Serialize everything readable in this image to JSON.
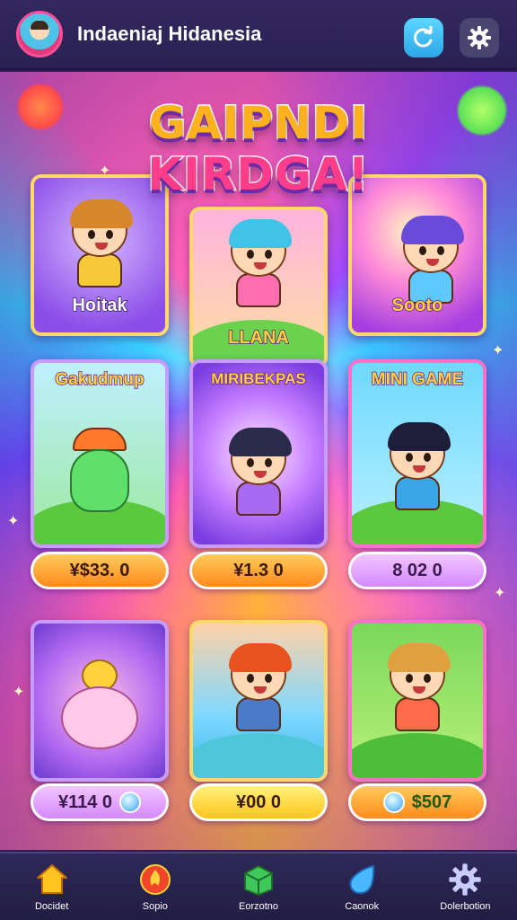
{
  "header": {
    "title": "Indaeniaj Hidanesia",
    "avatar_icon": "avatar-icon",
    "refresh_icon": "refresh-icon",
    "settings_icon": "gear-icon"
  },
  "logo": {
    "line1": "GAIPNDI",
    "line2": "KIRDGA!"
  },
  "cards": [
    {
      "title": "Hoitak"
    },
    {
      "title": "LLANA"
    },
    {
      "title": "Sooto"
    },
    {
      "title": "Gakudmup"
    },
    {
      "title": "MIRIBEKPAS"
    },
    {
      "title": "MINI GAME"
    }
  ],
  "prices": [
    "¥$33. 0",
    "¥1.3 0",
    "8 02 0",
    "¥114 0",
    "¥00 0",
    "$507"
  ],
  "nav": [
    {
      "label": "Docidet",
      "icon": "home-icon"
    },
    {
      "label": "Sopio",
      "icon": "fire-icon"
    },
    {
      "label": "Eorzotno",
      "icon": "box-icon"
    },
    {
      "label": "Caonok",
      "icon": "drop-icon"
    },
    {
      "label": "Dolerbotion",
      "icon": "gear-icon"
    }
  ],
  "colors": {
    "accent_cyan": "#38c8ff",
    "accent_pink": "#ff3d8b",
    "accent_gold": "#ffb21d",
    "frame_gold": "#ffd86a"
  }
}
